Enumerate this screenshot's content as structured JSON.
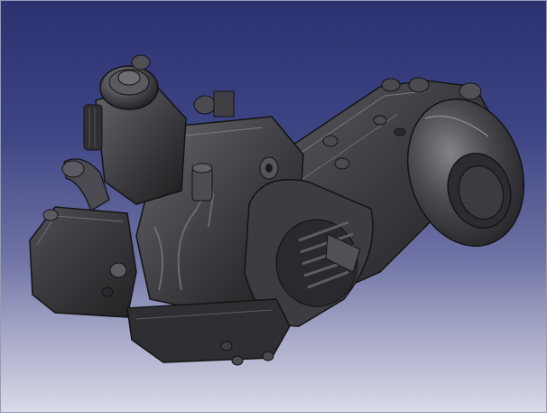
{
  "viewport": {
    "background_top": "#2c3170",
    "background_bottom": "#d9dae8",
    "model_color": "#3a3a3d",
    "model_highlight": "#7c7c82",
    "model_edge": "#151517"
  },
  "model": {
    "icon": "scooter-engine-3d-model-icon"
  }
}
